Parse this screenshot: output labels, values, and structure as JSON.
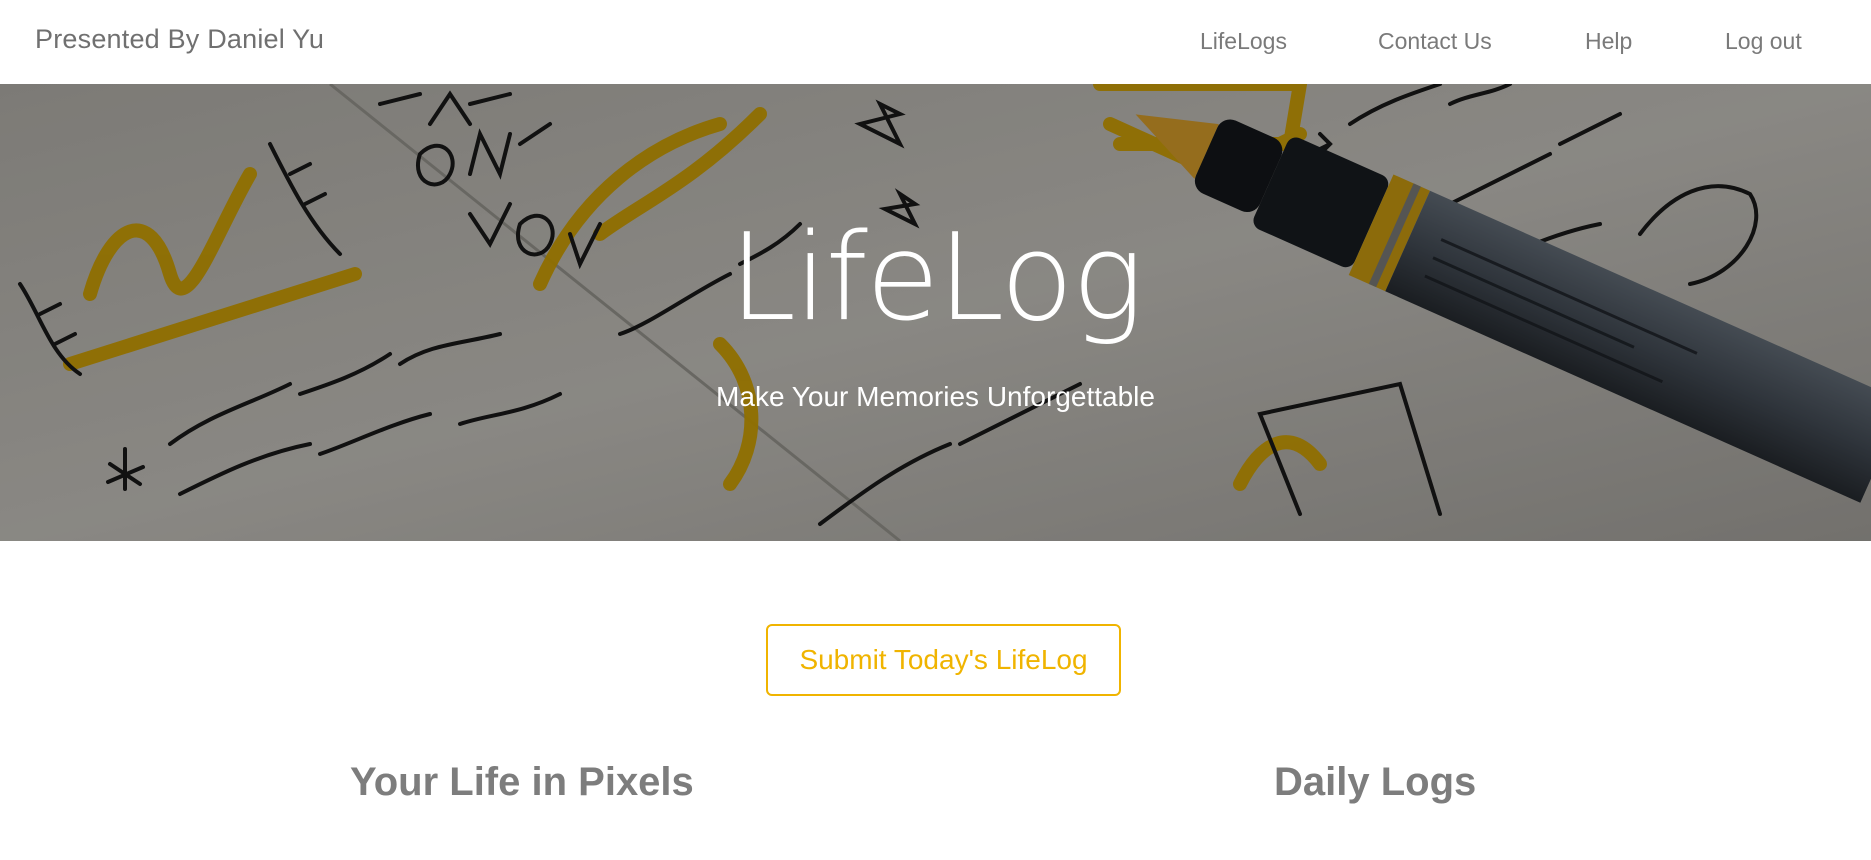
{
  "navbar": {
    "brand": "Presented By Daniel Yu",
    "links": [
      {
        "label": "LifeLogs"
      },
      {
        "label": "Contact Us"
      },
      {
        "label": "Help"
      },
      {
        "label": "Log out"
      }
    ]
  },
  "hero": {
    "title": "LifeLog",
    "subtitle": "Make Your Memories Unforgettable",
    "image": "journal-notebook-with-yellow-marker"
  },
  "cta": {
    "label": "Submit Today's LifeLog",
    "color": "#f0b400"
  },
  "sections": [
    {
      "heading": "Your Life in Pixels"
    },
    {
      "heading": "Daily Logs"
    }
  ]
}
